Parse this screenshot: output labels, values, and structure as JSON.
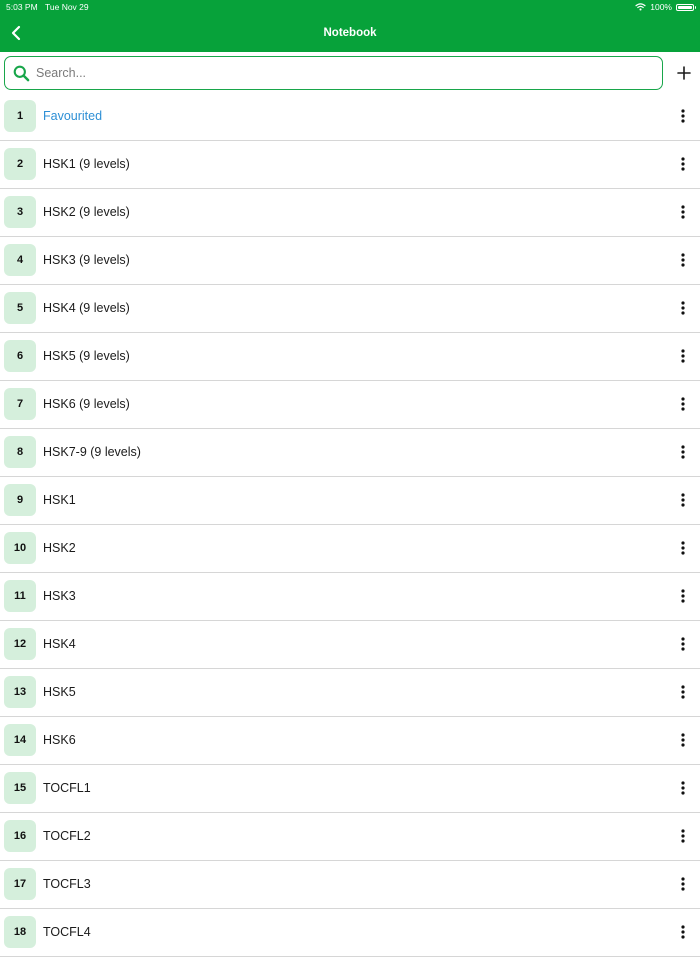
{
  "status_bar": {
    "time": "5:03 PM",
    "date": "Tue Nov 29",
    "battery": "100%"
  },
  "header": {
    "title": "Notebook",
    "background_color": "#07a23a",
    "back_icon": "chevron-left-icon"
  },
  "search": {
    "placeholder": "Search...",
    "value": "",
    "icon": "search-icon",
    "border_color": "#18a64a"
  },
  "add_button": {
    "icon": "plus-icon"
  },
  "notebooks": [
    {
      "number": "1",
      "label": "Favourited",
      "color": "#2d8fd5"
    },
    {
      "number": "2",
      "label": "HSK1 (9 levels)"
    },
    {
      "number": "3",
      "label": "HSK2 (9 levels)"
    },
    {
      "number": "4",
      "label": "HSK3 (9 levels)"
    },
    {
      "number": "5",
      "label": "HSK4 (9 levels)"
    },
    {
      "number": "6",
      "label": "HSK5 (9 levels)"
    },
    {
      "number": "7",
      "label": "HSK6 (9 levels)"
    },
    {
      "number": "8",
      "label": "HSK7-9 (9 levels)"
    },
    {
      "number": "9",
      "label": "HSK1"
    },
    {
      "number": "10",
      "label": "HSK2"
    },
    {
      "number": "11",
      "label": "HSK3"
    },
    {
      "number": "12",
      "label": "HSK4"
    },
    {
      "number": "13",
      "label": "HSK5"
    },
    {
      "number": "14",
      "label": "HSK6"
    },
    {
      "number": "15",
      "label": "TOCFL1"
    },
    {
      "number": "16",
      "label": "TOCFL2"
    },
    {
      "number": "17",
      "label": "TOCFL3"
    },
    {
      "number": "18",
      "label": "TOCFL4"
    }
  ],
  "item_menu_icon": "more-vertical-icon",
  "number_badge_color": "#d5efdc"
}
